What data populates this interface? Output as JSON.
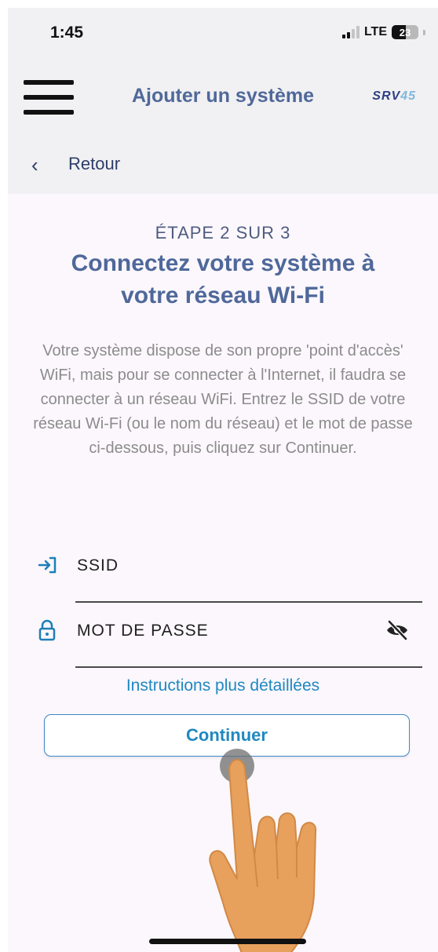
{
  "status": {
    "time": "1:45",
    "network": "LTE",
    "battery": "23"
  },
  "appbar": {
    "title": "Ajouter un système",
    "logo_text": "SRV",
    "logo_num": "45"
  },
  "back": {
    "label": "Retour"
  },
  "content": {
    "step": "ÉTAPE 2 SUR 3",
    "heading": "Connectez votre système à votre réseau Wi-Fi",
    "description": "Votre système dispose de son propre 'point d'accès' WiFi, mais pour se connecter à l'Internet, il faudra se connecter à un réseau WiFi. Entrez le SSID de votre réseau Wi-Fi (ou le nom du réseau) et le mot de passe ci-dessous, puis cliquez sur Continuer."
  },
  "form": {
    "ssid_placeholder": "SSID",
    "password_placeholder": "MOT DE PASSE"
  },
  "link": {
    "label": "Instructions plus détaillées"
  },
  "button": {
    "label": "Continuer"
  },
  "colors": {
    "accent": "#1f88c0",
    "title": "#4f689a",
    "hand": "#e8a05d"
  }
}
